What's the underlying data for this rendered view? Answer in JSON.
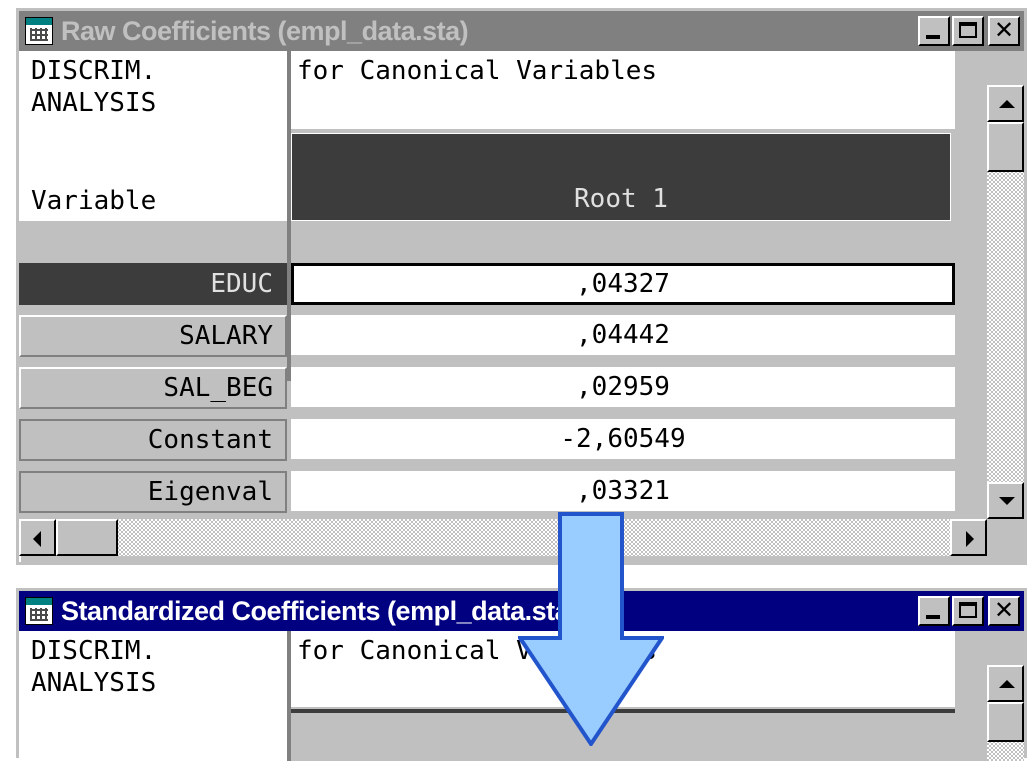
{
  "window1": {
    "title": "Raw Coefficients (empl_data.sta)",
    "header": {
      "line1": "DISCRIM.",
      "line2": "ANALYSIS",
      "subtitle": "for Canonical Variables",
      "variable_label": "Variable",
      "column_title": "Root 1"
    },
    "rows": [
      {
        "label": "EDUC",
        "value": ",04327"
      },
      {
        "label": "SALARY",
        "value": ",04442"
      },
      {
        "label": "SAL_BEG",
        "value": ",02959"
      },
      {
        "label": "Constant",
        "value": "-2,60549"
      },
      {
        "label": "Eigenval",
        "value": ",03321"
      }
    ]
  },
  "window2": {
    "title": "Standardized Coefficients (empl_data.sta)",
    "header": {
      "line1": "DISCRIM.",
      "line2": "ANALYSIS",
      "subtitle": "for Canonical Variables"
    }
  },
  "colors": {
    "inactive_title": "#808080",
    "active_title": "#000080",
    "selected_row": "#3c3c3c",
    "overlay_arrow_fill": "#99ccff",
    "overlay_arrow_stroke": "#2255cc"
  },
  "icons": [
    "app-grid-icon",
    "minimize-icon",
    "maximize-icon",
    "close-icon",
    "scroll-up-arrow-icon",
    "scroll-down-arrow-icon",
    "scroll-left-arrow-icon",
    "scroll-right-arrow-icon",
    "down-arrow-icon"
  ]
}
